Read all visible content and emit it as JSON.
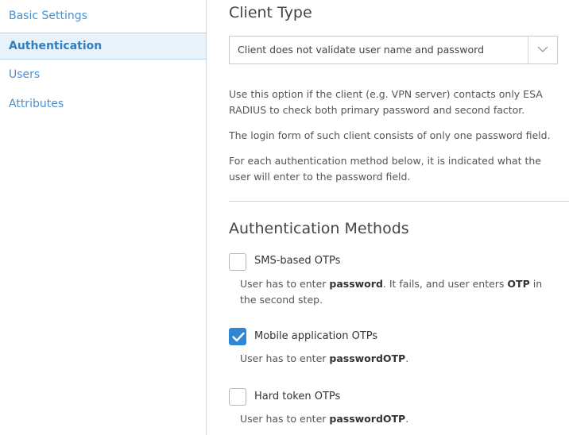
{
  "sidebar": {
    "items": [
      {
        "label": "Basic Settings"
      },
      {
        "label": "Authentication"
      },
      {
        "label": "Users"
      },
      {
        "label": "Attributes"
      }
    ]
  },
  "client_type": {
    "heading": "Client Type",
    "select_value": "Client does not validate user name and password",
    "para1": "Use this option if the client (e.g. VPN server) contacts only ESA RADIUS to check both primary password and second factor.",
    "para2": "The login form of such client consists of only one password field.",
    "para3": "For each authentication method below, it is indicated what the user will enter to the password field."
  },
  "auth_methods": {
    "heading": "Authentication Methods",
    "methods": [
      {
        "label": "SMS-based OTPs",
        "checked": false,
        "desc_prefix": "User has to enter ",
        "desc_bold1": "password",
        "desc_mid": ". It fails, and user enters ",
        "desc_bold2": "OTP",
        "desc_suffix": " in the second step."
      },
      {
        "label": "Mobile application OTPs",
        "checked": true,
        "desc_prefix": "User has to enter ",
        "desc_bold": "passwordOTP",
        "desc_suffix": "."
      },
      {
        "label": "Hard token OTPs",
        "checked": false,
        "desc_prefix": "User has to enter ",
        "desc_bold": "passwordOTP",
        "desc_suffix": "."
      }
    ]
  },
  "colors": {
    "accent": "#2f87d4",
    "link": "#4a90cf",
    "active_bg": "#e8f2fb"
  }
}
